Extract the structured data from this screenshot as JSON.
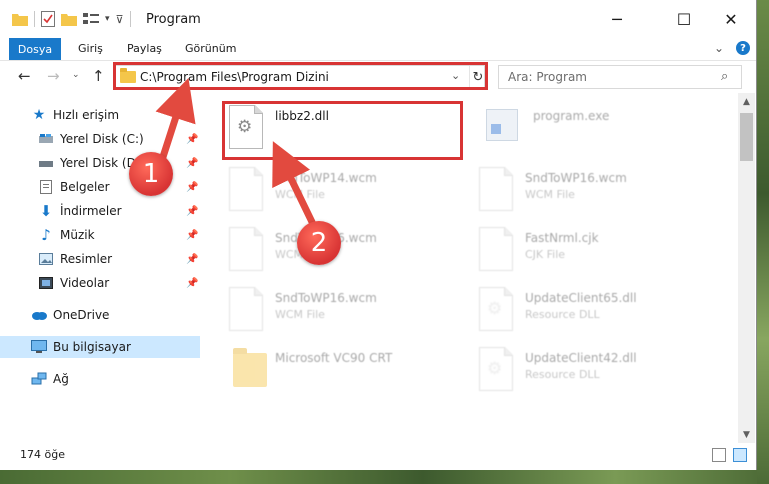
{
  "window": {
    "title": "Program",
    "controls": {
      "minimize": "─",
      "maximize": "☐",
      "close": "✕"
    }
  },
  "ribbon": {
    "file_tab": "Dosya",
    "tabs": [
      "Giriş",
      "Paylaş",
      "Görünüm"
    ]
  },
  "address": {
    "path": "C:\\Program Files\\Program Dizini"
  },
  "search": {
    "placeholder": "Ara: Program"
  },
  "nav": {
    "quick_access": "Hızlı erişim",
    "items": [
      {
        "label": "Yerel Disk (C:)",
        "icon": "drive-icon"
      },
      {
        "label": "Yerel Disk (D:)",
        "icon": "drive-icon"
      },
      {
        "label": "Belgeler",
        "icon": "documents-icon"
      },
      {
        "label": "İndirmeler",
        "icon": "downloads-icon"
      },
      {
        "label": "Müzik",
        "icon": "music-icon"
      },
      {
        "label": "Resimler",
        "icon": "pictures-icon"
      },
      {
        "label": "Videolar",
        "icon": "videos-icon"
      }
    ],
    "onedrive": "OneDrive",
    "this_pc": "Bu bilgisayar",
    "network": "Ağ"
  },
  "files": [
    {
      "name": "libbz2.dll",
      "type": ""
    },
    {
      "name": "program.exe",
      "type": ""
    },
    {
      "name": "SndToWP14.wcm",
      "type": "WCM File"
    },
    {
      "name": "SndToWP16.wcm",
      "type": "WCM File"
    },
    {
      "name": "SndToWP16.wcm",
      "type": "WCM File"
    },
    {
      "name": "FastNrml.cjk",
      "type": "CJK File"
    },
    {
      "name": "SndToWP16.wcm",
      "type": "WCM File"
    },
    {
      "name": "UpdateClient65.dll",
      "type": "Resource DLL"
    },
    {
      "name": "Microsoft VC90 CRT",
      "type": ""
    },
    {
      "name": "UpdateClient42.dll",
      "type": "Resource DLL"
    }
  ],
  "status": {
    "count": "174 öğe"
  },
  "annotations": {
    "step1": "1",
    "step2": "2",
    "color": "#d83434"
  }
}
